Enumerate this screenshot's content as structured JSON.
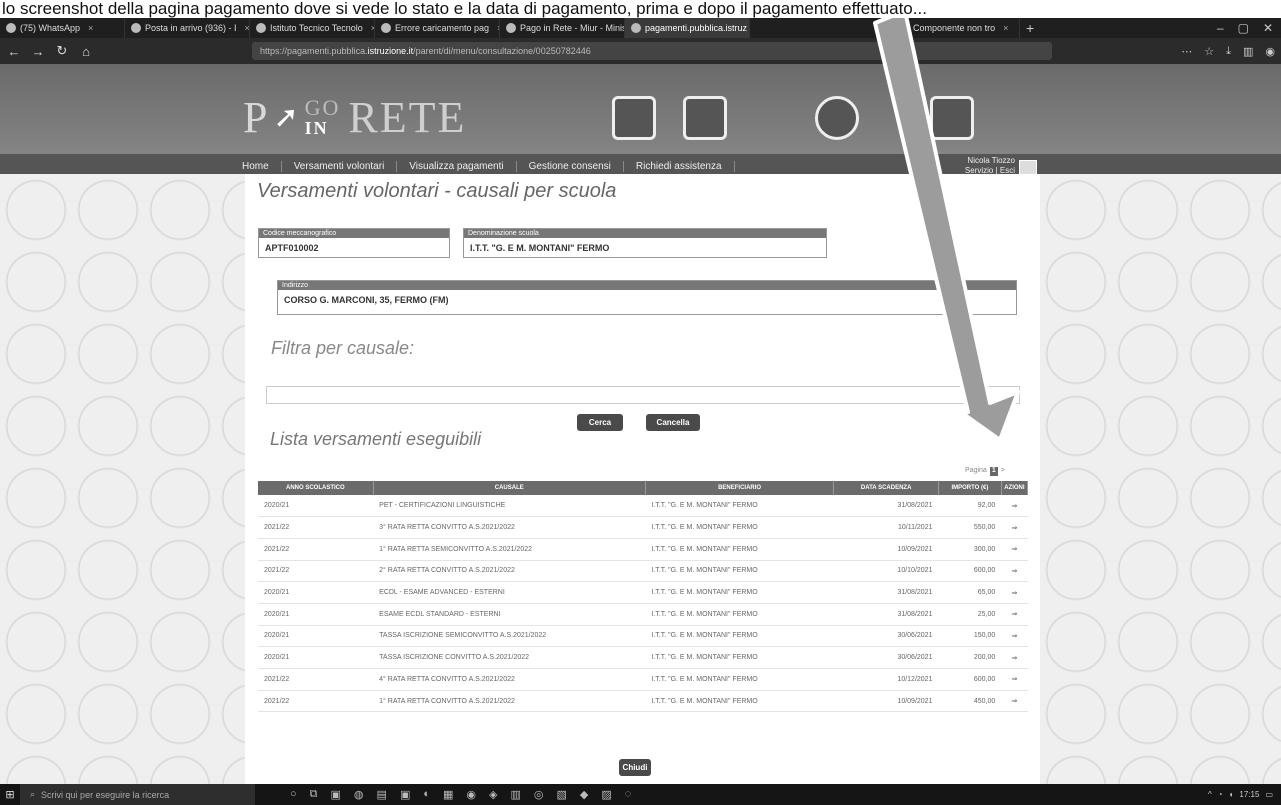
{
  "caption": "lo screenshot della pagina pagamento dove si vede lo stato e la data di pagamento, prima e dopo il pagamento effettuato...",
  "browser": {
    "tabs": [
      {
        "label": "(75) WhatsApp",
        "active": false
      },
      {
        "label": "Posta in arrivo (936) - I",
        "active": false
      },
      {
        "label": "Istituto Tecnico Tecnolo",
        "active": false
      },
      {
        "label": "Errore caricamento pag",
        "active": false
      },
      {
        "label": "Pago in Rete - Miur - Minis",
        "active": false
      },
      {
        "label": "pagamenti.pubblica.istruz",
        "active": true
      },
      {
        "label": "404 - Componente non tro",
        "active": false
      }
    ],
    "url_prefix": "https://pagamenti.pubblica.",
    "url_domain": "istruzione.it",
    "url_path": "/parent/di/menu/consultazione/00250782446"
  },
  "site": {
    "logo_p": "P",
    "logo_go": "GO",
    "logo_in": "IN",
    "logo_rete": "RETE",
    "menu": [
      "Home",
      "Versamenti volontari",
      "Visualizza pagamenti",
      "Gestione consensi",
      "Richiedi assistenza"
    ],
    "user_name": "Nicola Tiozzo",
    "user_role": "Servizio | Esci"
  },
  "page": {
    "title": "Versamenti volontari - causali per scuola",
    "codice_label": "Codice meccanografico",
    "codice_value": "APTF010002",
    "denominazione_label": "Denominazione scuola",
    "denominazione_value": "I.T.T. \"G. E M. MONTANI\" FERMO",
    "indirizzo_label": "Indirizzo",
    "indirizzo_value": "CORSO G. MARCONI, 35, FERMO (FM)",
    "filter_title": "Filtra per causale:",
    "cerca_label": "Cerca",
    "cancella_label": "Cancella",
    "list_title": "Lista versamenti eseguibili",
    "pager_label": "Pagina",
    "pager_current": "1",
    "pager_next": ">",
    "chiudi_label": "Chiudi"
  },
  "table": {
    "headers": [
      "ANNO SCOLASTICO",
      "CAUSALE",
      "BENEFICIARIO",
      "DATA SCADENZA",
      "IMPORTO (€)",
      "AZIONI"
    ],
    "rows": [
      [
        "2020/21",
        "PET - CERTIFICAZIONI LINGUISTICHE",
        "I.T.T. \"G. E M. MONTANI\" FERMO",
        "31/08/2021",
        "92,00"
      ],
      [
        "2021/22",
        "3° RATA RETTA CONVITTO A.S.2021/2022",
        "I.T.T. \"G. E M. MONTANI\" FERMO",
        "10/11/2021",
        "550,00"
      ],
      [
        "2021/22",
        "1° RATA RETTA SEMICONVITTO A.S.2021/2022",
        "I.T.T. \"G. E M. MONTANI\" FERMO",
        "10/09/2021",
        "300,00"
      ],
      [
        "2021/22",
        "2° RATA RETTA CONVITTO A.S.2021/2022",
        "I.T.T. \"G. E M. MONTANI\" FERMO",
        "10/10/2021",
        "600,00"
      ],
      [
        "2020/21",
        "ECDL - ESAME ADVANCED - ESTERNI",
        "I.T.T. \"G. E M. MONTANI\" FERMO",
        "31/08/2021",
        "65,00"
      ],
      [
        "2020/21",
        "ESAME ECDL STANDARD - ESTERNI",
        "I.T.T. \"G. E M. MONTANI\" FERMO",
        "31/08/2021",
        "25,00"
      ],
      [
        "2020/21",
        "TASSA ISCRIZIONE SEMICONVITTO A.S.2021/2022",
        "I.T.T. \"G. E M. MONTANI\" FERMO",
        "30/06/2021",
        "150,00"
      ],
      [
        "2020/21",
        "TASSA ISCRIZIONE CONVITTO A.S.2021/2022",
        "I.T.T. \"G. E M. MONTANI\" FERMO",
        "30/06/2021",
        "200,00"
      ],
      [
        "2021/22",
        "4° RATA RETTA CONVITTO A.S.2021/2022",
        "I.T.T. \"G. E M. MONTANI\" FERMO",
        "10/12/2021",
        "600,00"
      ],
      [
        "2021/22",
        "1° RATA RETTA CONVITTO A.S.2021/2022",
        "I.T.T. \"G. E M. MONTANI\" FERMO",
        "10/09/2021",
        "450,00"
      ]
    ]
  },
  "taskbar": {
    "search_placeholder": "Scrivi qui per eseguire la ricerca",
    "time": "17:15"
  },
  "colors": {
    "header_bg": "#777777",
    "button_bg": "#4a4a4a",
    "table_header": "#6b6b6b",
    "arrow": "#9a9a9a"
  }
}
